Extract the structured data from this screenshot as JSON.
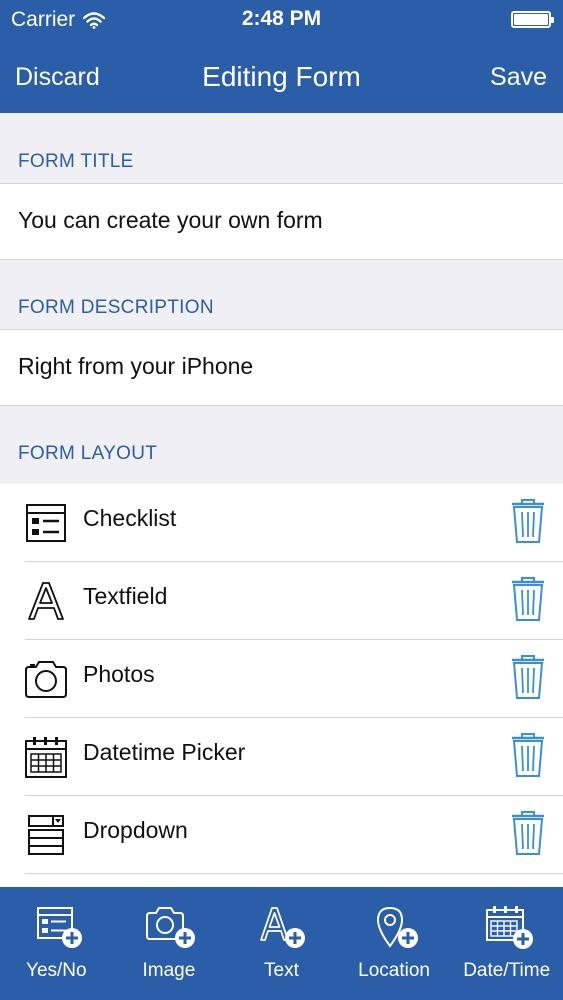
{
  "status_bar": {
    "carrier": "Carrier",
    "time": "2:48 PM"
  },
  "nav": {
    "left_button": "Discard",
    "title": "Editing Form",
    "right_button": "Save"
  },
  "form_title": {
    "header": "FORM TITLE",
    "value": "You can create your own form"
  },
  "form_description": {
    "header": "FORM DESCRIPTION",
    "value": "Right from your iPhone"
  },
  "form_layout": {
    "header": "FORM LAYOUT",
    "items": [
      {
        "label": "Checklist",
        "icon": "checklist-icon"
      },
      {
        "label": "Textfield",
        "icon": "textfield-icon"
      },
      {
        "label": "Photos",
        "icon": "camera-icon"
      },
      {
        "label": "Datetime Picker",
        "icon": "calendar-icon"
      },
      {
        "label": "Dropdown",
        "icon": "dropdown-icon"
      }
    ]
  },
  "tab_bar": {
    "items": [
      {
        "label": "Yes/No",
        "icon": "add-checklist-icon"
      },
      {
        "label": "Image",
        "icon": "add-image-icon"
      },
      {
        "label": "Text",
        "icon": "add-text-icon"
      },
      {
        "label": "Location",
        "icon": "add-location-icon"
      },
      {
        "label": "Date/Time",
        "icon": "add-datetime-icon"
      }
    ]
  },
  "colors": {
    "brand": "#2b5ea8",
    "accent_icon": "#3a8fd9",
    "background": "#efeff4"
  }
}
